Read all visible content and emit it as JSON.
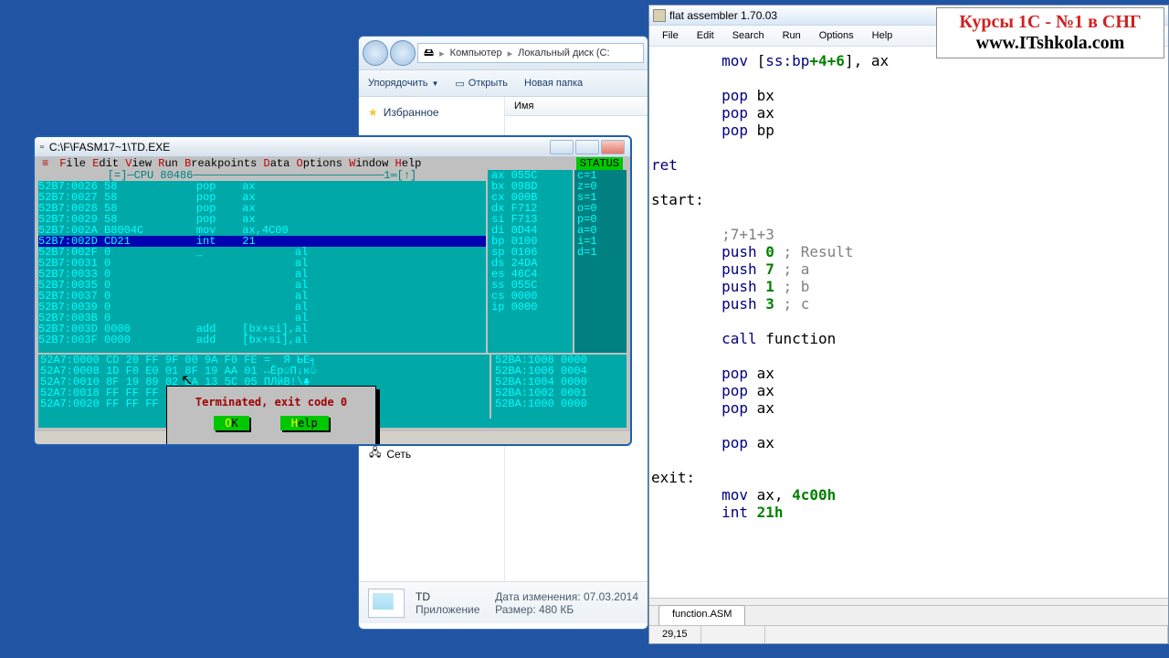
{
  "fasm": {
    "title": "flat assembler 1.70.03",
    "menu": [
      "File",
      "Edit",
      "Search",
      "Run",
      "Options",
      "Help"
    ],
    "code": [
      {
        "indent": 2,
        "kw": "mov",
        "rest": " [",
        "kw2": "ss:bp",
        "plus": "+4+6",
        "rest2": "], ax"
      },
      {
        "blank": true
      },
      {
        "indent": 2,
        "kw": "pop",
        "rest": " bx"
      },
      {
        "indent": 2,
        "kw": "pop",
        "rest": " ax"
      },
      {
        "indent": 2,
        "kw": "pop",
        "rest": " bp"
      },
      {
        "blank": true
      },
      {
        "indent": 0,
        "kw": "ret"
      },
      {
        "blank": true
      },
      {
        "indent": 0,
        "label": "start:"
      },
      {
        "blank": true
      },
      {
        "indent": 2,
        "comment": ";7+1+3"
      },
      {
        "indent": 2,
        "kw": "push",
        "num": " 0",
        "comment": " ; Result"
      },
      {
        "indent": 2,
        "kw": "push",
        "num": " 7",
        "comment": " ; a"
      },
      {
        "indent": 2,
        "kw": "push",
        "num": " 1",
        "comment": " ; b"
      },
      {
        "indent": 2,
        "kw": "push",
        "num": " 3",
        "comment": " ; c"
      },
      {
        "blank": true
      },
      {
        "indent": 2,
        "kw": "call",
        "rest": " function"
      },
      {
        "blank": true
      },
      {
        "indent": 2,
        "kw": "pop",
        "rest": " ax"
      },
      {
        "indent": 2,
        "kw": "pop",
        "rest": " ax"
      },
      {
        "indent": 2,
        "kw": "pop",
        "rest": " ax"
      },
      {
        "blank": true
      },
      {
        "indent": 2,
        "kw": "pop",
        "rest": " ax"
      },
      {
        "blank": true
      },
      {
        "indent": 0,
        "label": "exit:"
      },
      {
        "indent": 2,
        "kw": "mov",
        "rest": " ax, ",
        "num": "4c00h"
      },
      {
        "indent": 2,
        "kw": "int",
        "num": " 21h"
      }
    ],
    "tab": "function.ASM",
    "status_pos": "29,15"
  },
  "advert": {
    "line1": "Курсы 1С - №1 в СНГ",
    "line2": "www.ITshkola.com"
  },
  "explorer": {
    "crumbs": [
      "Компьютер",
      "Локальный диск (C:"
    ],
    "toolbar": {
      "organize": "Упорядочить",
      "open": "Открыть",
      "newfolder": "Новая папка"
    },
    "fav": "Избранное",
    "col_name": "Имя",
    "network": "Сеть",
    "file": {
      "name": "TD",
      "type": "Приложение",
      "mod_label": "Дата изменения:",
      "mod": "07.03.2014",
      "size_label": "Размер:",
      "size": "480 КБ"
    }
  },
  "td": {
    "title": "C:\\F\\FASM17~1\\TD.EXE",
    "menus": [
      "File",
      "Edit",
      "View",
      "Run",
      "Breakpoints",
      "Data",
      "Options",
      "Window",
      "Help"
    ],
    "first_letters": [
      "F",
      "E",
      "V",
      "R",
      "B",
      "D",
      "O",
      "W",
      "H"
    ],
    "status": "STATUS",
    "cpu_header": "[=]─CPU 80486─────────────────────────────1═[↑]",
    "cpu": [
      "52B7:0026 58            pop    ax",
      "52B7:0027 58            pop    ax",
      "52B7:0028 58            pop    ax",
      "52B7:0029 58            pop    ax",
      "52B7:002A B8004C        mov    ax,4C00",
      "52B7:002D CD21          int    21",
      "52B7:002F 0             _              al",
      "52B7:0031 0                            al",
      "52B7:0033 0                            al",
      "52B7:0035 0                            al",
      "52B7:0037 0                            al",
      "52B7:0039 0                            al",
      "52B7:003B 0                            al",
      "52B7:003D 0000          add    [bx+si],al",
      "52B7:003F 0000          add    [bx+si],al"
    ],
    "selected_row": 5,
    "registers": [
      "ax 055C",
      "bx 098D",
      "cx 000B",
      "dx F712",
      "si F713",
      "di 0D44",
      "bp 0100",
      "sp 0106",
      "ds 24DA",
      "es 46C4",
      "ss 055C",
      "cs 0000",
      "ip 0000"
    ],
    "flags": [
      "c=1",
      "z=0",
      "s=1",
      "o=0",
      "p=0",
      "a=0",
      "i=1",
      "d=1"
    ],
    "dump": [
      "52A7:0000 CD 20 FF 9F 00 9A F0 FE =  Я ЬЕ╕",
      "52A7:0008 1D F0 E0 01 8F 19 AA 01 ↔Ёр☺П↓к☺",
      "52A7:0010 8F 19 89 02 EA 13 5C 05 ПЛйВ!\\♣",
      "52A7:0018 FF FF FF FF FF FF FF FF",
      "52A7:0020 FF FF FF FF FF FF FF FF"
    ],
    "stack": [
      "52BA:1008 0000",
      "52BA:1006 0004",
      "52BA:1004 0000",
      "52BA:1002 0001",
      "52BA:1000 0000"
    ],
    "dialog": {
      "msg": "Terminated, exit code 0",
      "ok": "OK",
      "help": "Help"
    }
  }
}
